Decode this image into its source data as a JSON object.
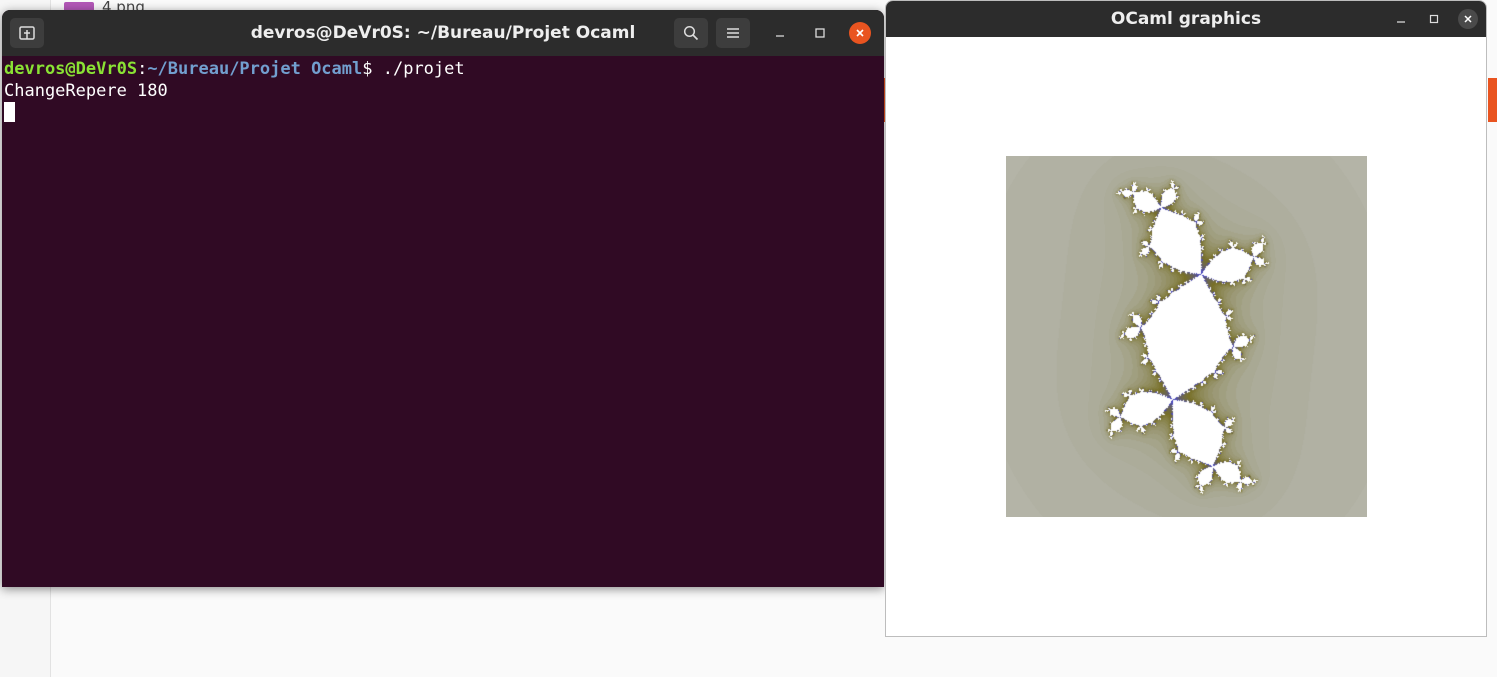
{
  "background": {
    "file_name": "4.png"
  },
  "terminal": {
    "title": "devros@DeVr0S: ~/Bureau/Projet Ocaml",
    "prompt_user": "devros@DeVr0S",
    "prompt_sep": ":",
    "prompt_path": "~/Bureau/Projet Ocaml",
    "prompt_symbol": "$ ",
    "command": "./projet",
    "output_line": "ChangeRepere 180",
    "icons": {
      "new_tab": "new-tab-icon",
      "search": "search-icon",
      "menu": "hamburger-menu-icon",
      "minimize": "minimize-icon",
      "maximize": "maximize-icon",
      "close": "close-icon"
    },
    "colors": {
      "background": "#300a24",
      "user": "#8ae234",
      "path": "#729fcf",
      "close_button": "#e95420"
    }
  },
  "graphics_window": {
    "title": "OCaml graphics",
    "fractal": {
      "type": "julia-set",
      "colors": {
        "interior": "#ffffff",
        "background_gray": "#b3b3a8",
        "mid_olive": "#7a7426",
        "boundary_blue": "#5050d0"
      }
    }
  }
}
